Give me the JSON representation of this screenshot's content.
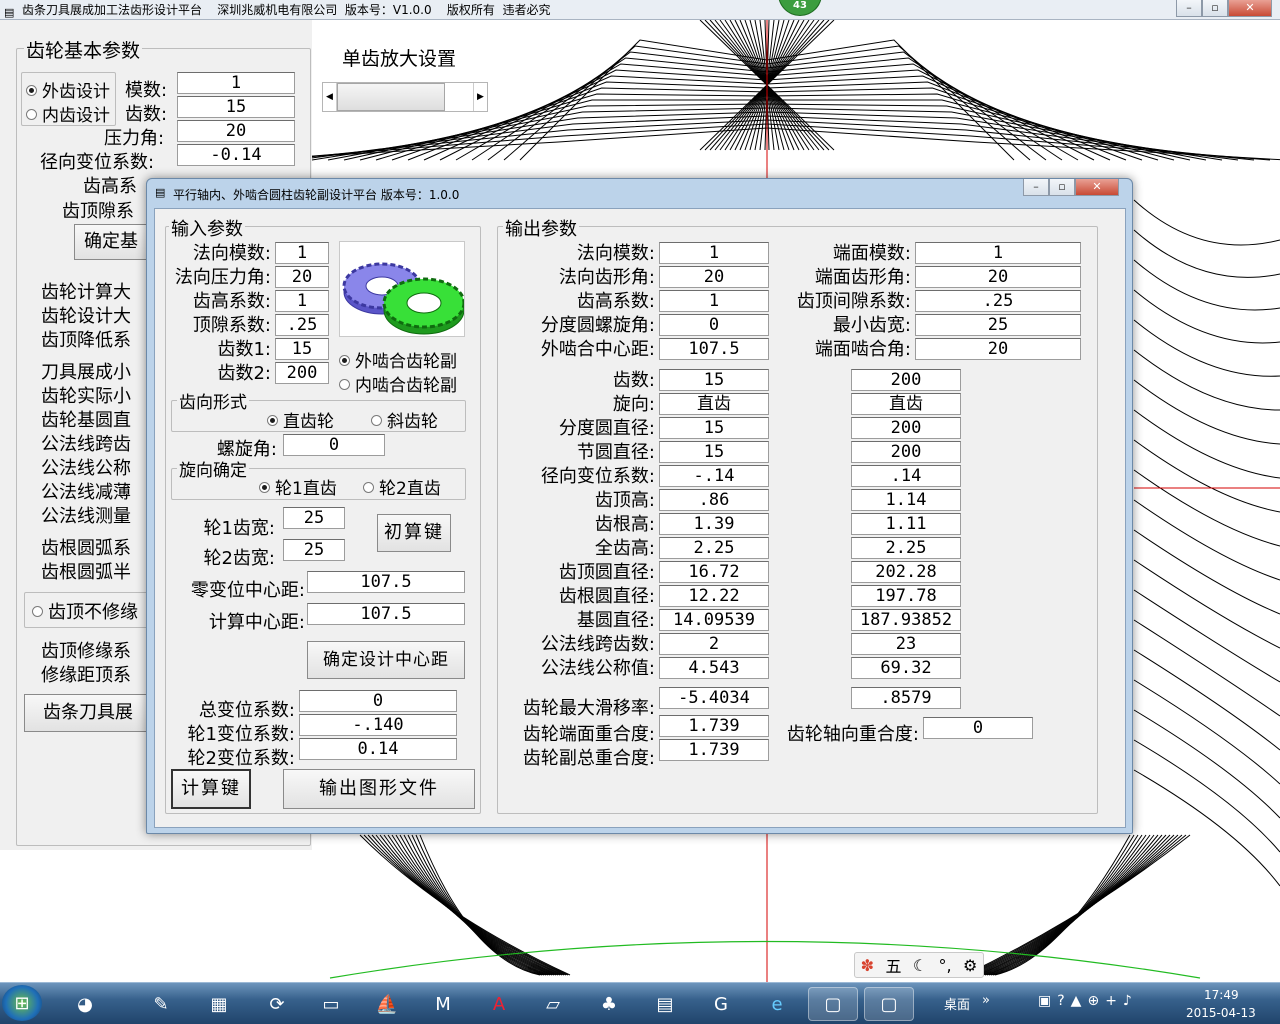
{
  "main_window": {
    "title": "齿条刀具展成加工法齿形设计平台    深圳兆威机电有限公司  版本号：V1.0.0    版权所有  违者必究",
    "counter_badge": "43",
    "gear_params_title": "齿轮基本参数",
    "external_radio": "外齿设计",
    "internal_radio": "内齿设计",
    "module_label": "模数:",
    "module_value": "1",
    "teeth_label": "齿数:",
    "teeth_value": "15",
    "pressure_label": "压力角:",
    "pressure_value": "20",
    "shift_label": "径向变位系数:",
    "shift_value": "-0.14",
    "addendum_label": "齿高系",
    "clearance_label": "齿顶隙系",
    "confirm_btn": "确定基",
    "enlarge_title": "单齿放大设置",
    "side_labels": [
      "齿轮计算大",
      "齿轮设计大",
      "齿顶降低系",
      "刀具展成小",
      "齿轮实际小",
      "齿轮基圆直",
      "公法线跨齿",
      "公法线公称",
      "公法线减薄",
      "公法线测量",
      "齿根圆弧系",
      "齿根圆弧半"
    ],
    "tip_no_modify": "齿顶不修缘",
    "tip_modify_label": "齿顶修缘系",
    "tip_distance_label": "修缘距顶系",
    "rack_btn": "齿条刀具展"
  },
  "dialog": {
    "title": "平行轴内、外啮合圆柱齿轮副设计平台 版本号：1.0.0",
    "input_title": "输入参数",
    "output_title": "输出参数",
    "inputs": {
      "normal_module_label": "法向模数:",
      "normal_module": "1",
      "normal_pressure_label": "法向压力角:",
      "normal_pressure": "20",
      "addendum_coef_label": "齿高系数:",
      "addendum_coef": "1",
      "clearance_coef_label": "顶隙系数:",
      "clearance_coef": ".25",
      "teeth1_label": "齿数1:",
      "teeth1": "15",
      "teeth2_label": "齿数2:",
      "teeth2": "200",
      "external_pair": "外啮合齿轮副",
      "internal_pair": "内啮合齿轮副",
      "tooth_form_title": "齿向形式",
      "spur": "直齿轮",
      "helical": "斜齿轮",
      "helix_angle_label": "螺旋角:",
      "helix_angle": "0",
      "direction_title": "旋向确定",
      "dir1": "轮1直齿",
      "dir2": "轮2直齿",
      "width1_label": "轮1齿宽:",
      "width1": "25",
      "width2_label": "轮2齿宽:",
      "width2": "25",
      "initial_calc_btn": "初算键",
      "zero_center_label": "零变位中心距:",
      "zero_center": "107.5",
      "calc_center_label": "计算中心距:",
      "calc_center": "107.5",
      "confirm_center_btn": "确定设计中心距",
      "total_shift_label": "总变位系数:",
      "total_shift": "0",
      "shift1_label": "轮1变位系数:",
      "shift1": "-.140",
      "shift2_label": "轮2变位系数:",
      "shift2": "0.14",
      "calc_btn": "计算键",
      "export_btn": "输出图形文件"
    },
    "outputs": {
      "normal_module_label": "法向模数:",
      "normal_module": "1",
      "normal_profile_label": "法向齿形角:",
      "normal_profile": "20",
      "addendum_label": "齿高系数:",
      "addendum": "1",
      "helix_label": "分度圆螺旋角:",
      "helix": "0",
      "ext_center_label": "外啮合中心距:",
      "ext_center": "107.5",
      "transverse_module_label": "端面模数:",
      "transverse_module": "1",
      "transverse_profile_label": "端面齿形角:",
      "transverse_profile": "20",
      "tip_clearance_label": "齿顶间隙系数:",
      "tip_clearance": ".25",
      "min_width_label": "最小齿宽:",
      "min_width": "25",
      "transverse_mesh_label": "端面啮合角:",
      "transverse_mesh": "20",
      "rows": [
        {
          "label": "齿数:",
          "g1": "15",
          "g2": "200"
        },
        {
          "label": "旋向:",
          "g1": "直齿",
          "g2": "直齿"
        },
        {
          "label": "分度圆直径:",
          "g1": "15",
          "g2": "200"
        },
        {
          "label": "节圆直径:",
          "g1": "15",
          "g2": "200"
        },
        {
          "label": "径向变位系数:",
          "g1": "-.14",
          "g2": ".14"
        },
        {
          "label": "齿顶高:",
          "g1": ".86",
          "g2": "1.14"
        },
        {
          "label": "齿根高:",
          "g1": "1.39",
          "g2": "1.11"
        },
        {
          "label": "全齿高:",
          "g1": "2.25",
          "g2": "2.25"
        },
        {
          "label": "齿顶圆直径:",
          "g1": "16.72",
          "g2": "202.28"
        },
        {
          "label": "齿根圆直径:",
          "g1": "12.22",
          "g2": "197.78"
        },
        {
          "label": "基圆直径:",
          "g1": "14.09539",
          "g2": "187.93852"
        },
        {
          "label": "公法线跨齿数:",
          "g1": "2",
          "g2": "23"
        },
        {
          "label": "公法线公称值:",
          "g1": "4.543",
          "g2": "69.32"
        }
      ],
      "max_slip_label": "齿轮最大滑移率:",
      "max_slip1": "-5.4034",
      "max_slip2": ".8579",
      "transverse_contact_label": "齿轮端面重合度:",
      "transverse_contact": "1.739",
      "total_contact_label": "齿轮副总重合度:",
      "total_contact": "1.739",
      "axial_contact_label": "齿轮轴向重合度:",
      "axial_contact": "0"
    }
  },
  "ime_bar": {
    "mode": "五"
  },
  "taskbar": {
    "desktop_label": "桌面",
    "time": "17:49",
    "date": "2015-04-13"
  }
}
